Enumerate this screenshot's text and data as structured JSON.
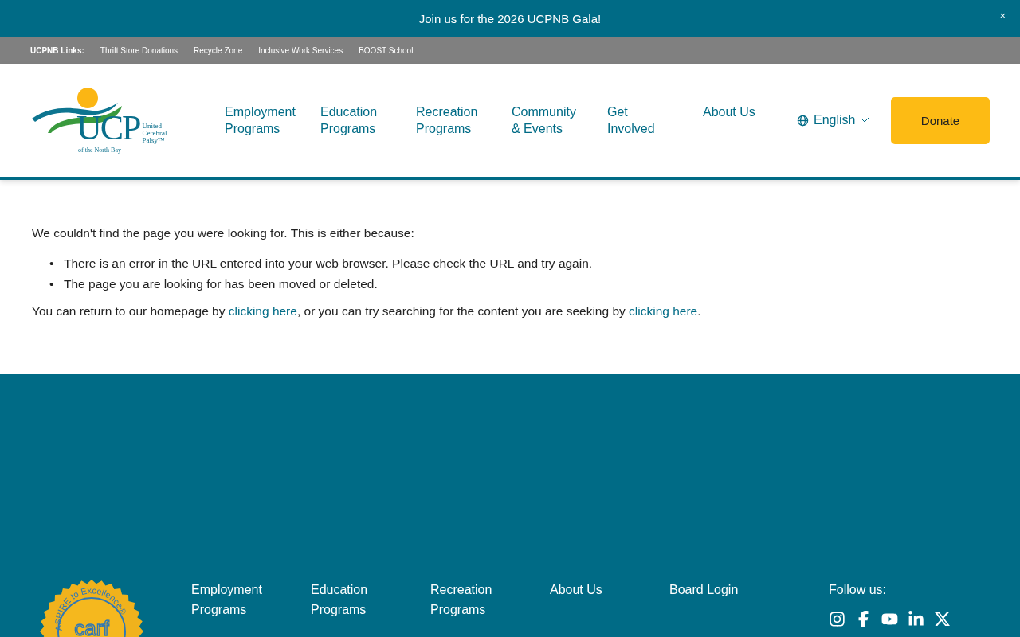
{
  "announcement": {
    "text": "Join us for the 2026 UCPNB Gala!",
    "close": "×"
  },
  "links_bar": {
    "label": "UCPNB Links:",
    "links": [
      "Thrift Store Donations",
      "Recycle Zone",
      "Inclusive Work Services",
      "BOOST School"
    ]
  },
  "logo": {
    "letters": "UCP",
    "name_lines": [
      "United",
      "Cerebral",
      "Palsy™"
    ],
    "tagline": "of the North Bay"
  },
  "nav": [
    {
      "lines": [
        "Employment",
        "Programs"
      ]
    },
    {
      "lines": [
        "Education",
        "Programs"
      ]
    },
    {
      "lines": [
        "Recreation",
        "Programs"
      ]
    },
    {
      "lines": [
        "Community",
        "& Events"
      ]
    },
    {
      "lines": [
        "Get",
        "Involved"
      ]
    },
    {
      "lines": [
        "About Us"
      ]
    }
  ],
  "language": "English",
  "donate": "Donate",
  "content": {
    "intro": "We couldn't find the page you were looking for. This is either because:",
    "reasons": [
      {
        "marker": "•",
        "text": "There is an error in the URL entered into your web browser. Please check the URL and try again."
      },
      {
        "marker": "•",
        "text": "The page you are looking for has been moved or deleted."
      }
    ],
    "return_parts": [
      {
        "kind": "text",
        "text": "You can return to our homepage by "
      },
      {
        "kind": "link",
        "text": "clicking here"
      },
      {
        "kind": "text",
        "text": ", or you can try searching for the content you are seeking by "
      },
      {
        "kind": "link",
        "text": "clicking here"
      },
      {
        "kind": "text",
        "text": "."
      }
    ]
  },
  "footer": {
    "seal": {
      "ring_text": "ASPIRE to Excellence®",
      "center_text": "carf"
    },
    "columns": [
      {
        "lines": [
          "Employment",
          "Programs"
        ]
      },
      {
        "lines": [
          "Education",
          "Programs"
        ]
      },
      {
        "lines": [
          "Recreation",
          "Programs"
        ]
      },
      {
        "lines": [
          "About Us"
        ]
      },
      {
        "lines": [
          "Board Login"
        ]
      }
    ],
    "follow": "Follow us:",
    "social": [
      {
        "kind": "instagram"
      },
      {
        "kind": "facebook"
      },
      {
        "kind": "youtube"
      },
      {
        "kind": "linkedin"
      },
      {
        "kind": "x"
      }
    ]
  }
}
